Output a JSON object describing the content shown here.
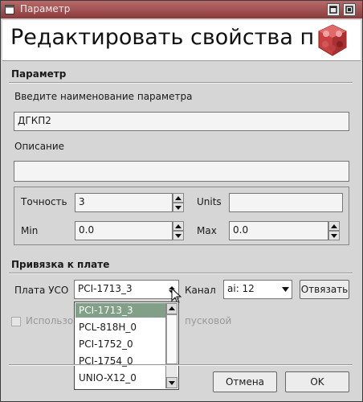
{
  "window": {
    "title": "Параметр",
    "icon": "app-window-icon",
    "buttons": [
      "maximize-icon",
      "restore-icon"
    ]
  },
  "banner": {
    "heading": "Редактировать свойства п",
    "logo": "3d-cube-logo-icon"
  },
  "parameter_section": {
    "title": "Параметр",
    "name_label": "Введите наименование параметра",
    "name_value": "ДГКП2",
    "description_label": "Описание",
    "description_value": "",
    "precision_label": "Точность",
    "precision_value": "3",
    "units_label": "Units",
    "units_value": "",
    "min_label": "Min",
    "min_value": "0.0",
    "max_label": "Max",
    "max_value": "0.0"
  },
  "binding_section": {
    "title": "Привязка к плате",
    "board_label": "Плата УСО",
    "board_value": "PCI-1713_3",
    "channel_label": "Канал",
    "channel_value": "ai: 12",
    "unbind_button": "Отвязать",
    "checkbox_left": "Использо",
    "checkbox_right": "пусковой",
    "dropdown_options": [
      "PCI-1713_3",
      "PCL-818H_0",
      "PCI-1752_0",
      "PCI-1754_0",
      "UNIO-X12_0"
    ],
    "selected_option": "PCI-1713_3"
  },
  "footer": {
    "cancel_button": "Отмена",
    "ok_button": "OK"
  },
  "colors": {
    "title_bar": "#9a4a4a",
    "selected_option": "#82a088",
    "logo": "#cc4444"
  }
}
